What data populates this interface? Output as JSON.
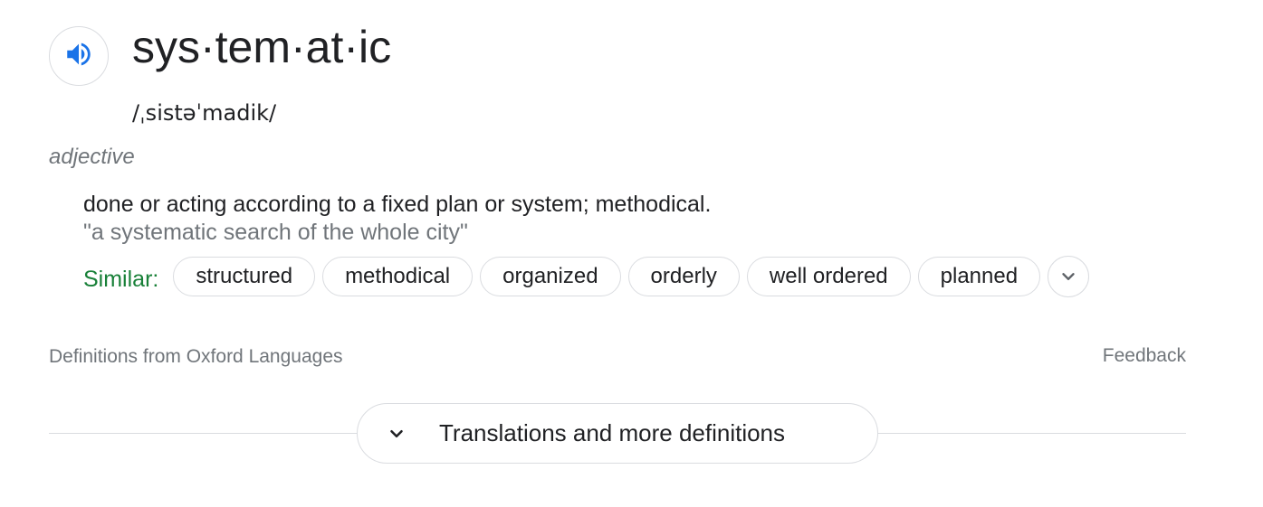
{
  "entry": {
    "headword": "sys·tem·at·ic",
    "pronunciation": "/ˌsistəˈmadik/",
    "part_of_speech": "adjective",
    "definition": "done or acting according to a fixed plan or system; methodical.",
    "example": "\"a systematic search of the whole city\""
  },
  "similar": {
    "label": "Similar:",
    "words": [
      "structured",
      "methodical",
      "organized",
      "orderly",
      "well ordered",
      "planned"
    ]
  },
  "footer": {
    "source": "Definitions from Oxford Languages",
    "feedback": "Feedback"
  },
  "more_button": {
    "label": "Translations and more definitions"
  },
  "icons": {
    "audio": "speaker-icon",
    "expand": "chevron-down-icon"
  },
  "colors": {
    "accent_blue": "#1a73e8",
    "similar_green": "#188038",
    "secondary_text": "#70757a",
    "border": "#dadce0"
  }
}
